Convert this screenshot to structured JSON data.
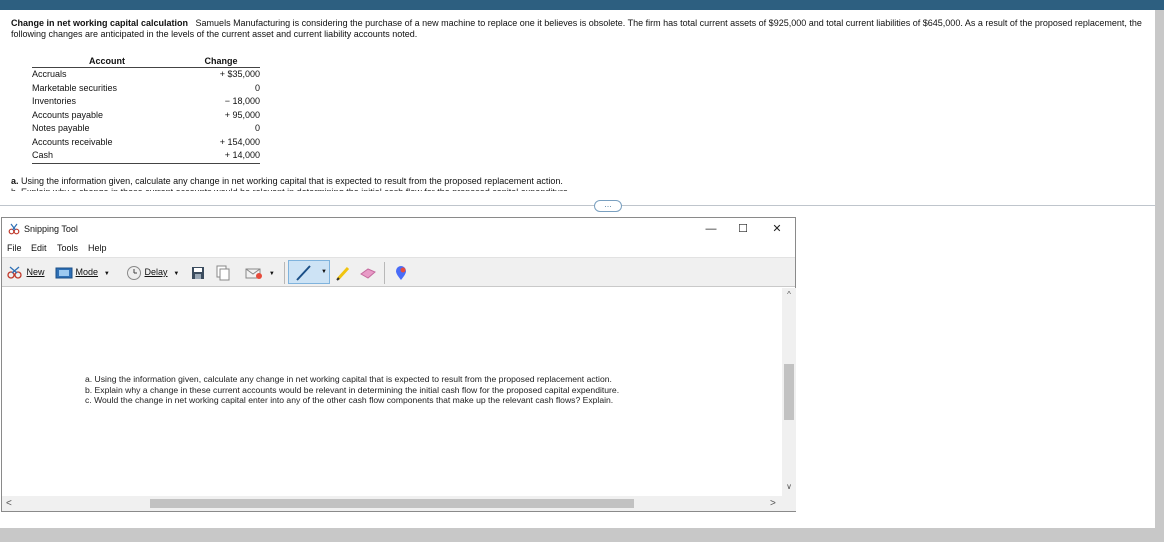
{
  "document": {
    "title": "Change in net working capital calculation",
    "intro": "Samuels Manufacturing is considering the purchase of a new machine to replace one it believes is obsolete.  The firm has total current assets of $925,000 and total current liabilities of $645,000.  As a result of the proposed replacement, the following changes are anticipated in the levels of the current asset and current liability accounts noted.",
    "table": {
      "headers": [
        "Account",
        "Change"
      ],
      "rows": [
        {
          "account": "Accruals",
          "change": "+ $35,000"
        },
        {
          "account": "Marketable securities",
          "change": "0"
        },
        {
          "account": "Inventories",
          "change": "− 18,000"
        },
        {
          "account": "Accounts payable",
          "change": "+ 95,000"
        },
        {
          "account": "Notes payable",
          "change": "0"
        },
        {
          "account": "Accounts receivable",
          "change": "+ 154,000"
        },
        {
          "account": "Cash",
          "change": "+ 14,000"
        }
      ]
    },
    "question_a_label": "a.",
    "question_a_text": "Using the information given, calculate any change in net working capital that is expected to result from the proposed replacement action.",
    "question_b_cutoff": "b.  Explain why a change in these current accounts would be relevant in determining the initial cash flow for the proposed capital expenditure.",
    "expander_label": "…"
  },
  "snipping_tool": {
    "title": "Snipping Tool",
    "window_controls": {
      "minimize": "—",
      "maximize": "☐",
      "close": "✕"
    },
    "menu": [
      "File",
      "Edit",
      "Tools",
      "Help"
    ],
    "toolbar": {
      "new_label": "New",
      "mode_label": "Mode",
      "delay_label": "Delay"
    },
    "capture_lines": [
      "a. Using the information given, calculate any change in net working capital that is expected to result from the proposed replacement action.",
      "b. Explain why a change in these current accounts would be relevant in determining the initial cash flow for the proposed capital expenditure.",
      "c. Would the change in net working capital enter into any of the other cash flow components that make up the relevant cash flows? Explain."
    ]
  },
  "colors": {
    "topbar": "#2d5f80",
    "toolbar_bg": "#f0f0f0",
    "pen_highlight": "#cde3f5"
  },
  "icons": [
    "snipping-tool-icon",
    "new-snip-icon",
    "mode-icon",
    "delay-clock-icon",
    "save-icon",
    "copy-icon",
    "send-snip-icon",
    "pen-icon",
    "highlighter-icon",
    "eraser-icon",
    "paint-3d-icon"
  ]
}
